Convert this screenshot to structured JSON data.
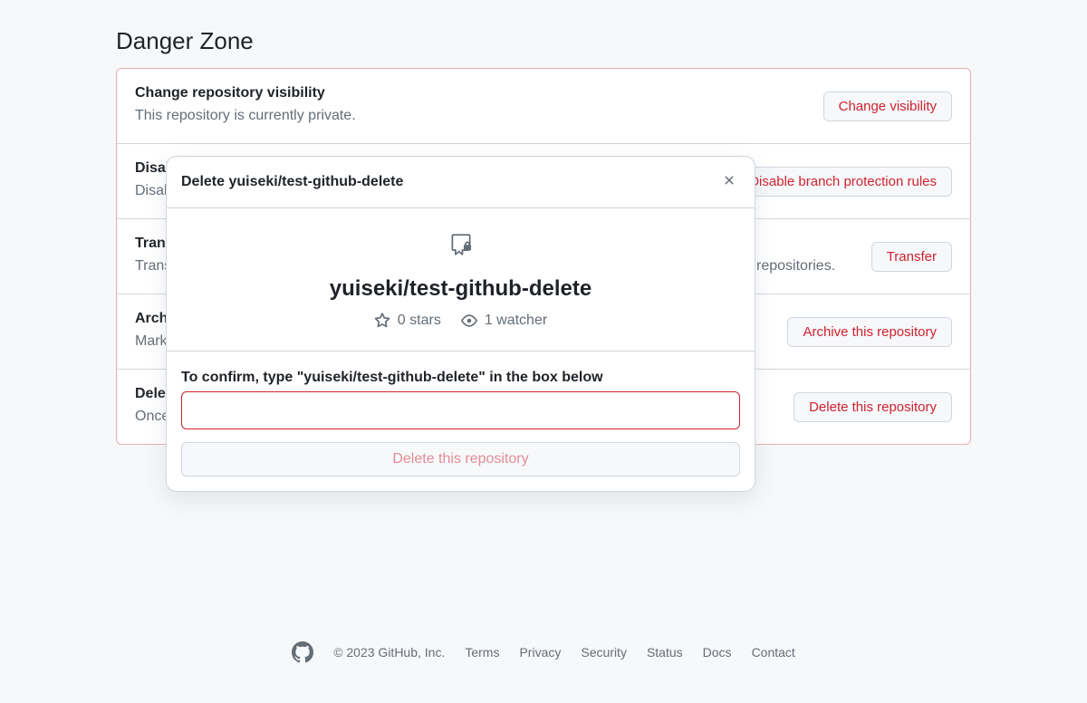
{
  "header": {
    "title": "Danger Zone"
  },
  "danger_zone": {
    "items": [
      {
        "title": "Change repository visibility",
        "desc": "This repository is currently private.",
        "button": "Change visibility"
      },
      {
        "title": "Disable branch protection rules",
        "desc": "Disable branch protection rules enforcement and APIs",
        "button": "Disable branch protection rules"
      },
      {
        "title": "Transfer ownership",
        "desc": "Transfer this repository to another user or to an organization where you have the ability to create repositories.",
        "button": "Transfer"
      },
      {
        "title": "Archive this repository",
        "desc": "Mark this repository as archived and read-only.",
        "button": "Archive this repository"
      },
      {
        "title": "Delete this repository",
        "desc": "Once you delete a repository, there is no going back. Please be certain.",
        "button": "Delete this repository"
      }
    ]
  },
  "modal": {
    "title": "Delete yuiseki/test-github-delete",
    "repo_full_name": "yuiseki/test-github-delete",
    "stars_label": "0 stars",
    "watchers_label": "1 watcher",
    "confirm_text": "To confirm, type \"yuiseki/test-github-delete\" in the box below",
    "confirm_button": "Delete this repository"
  },
  "footer": {
    "copyright": "© 2023 GitHub, Inc.",
    "links": [
      "Terms",
      "Privacy",
      "Security",
      "Status",
      "Docs",
      "Contact"
    ]
  }
}
